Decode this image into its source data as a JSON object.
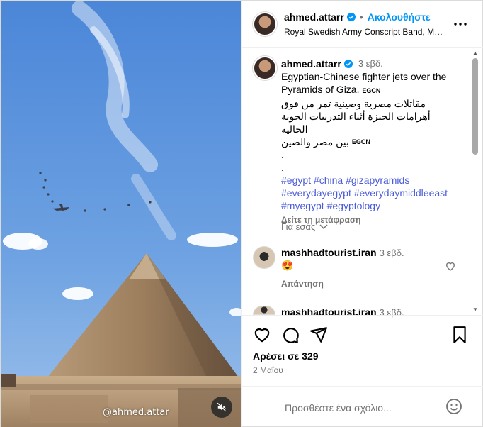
{
  "header": {
    "username": "ahmed.attarr",
    "separator": "•",
    "follow_label": "Ακολουθήστε",
    "subtitle": "Royal Swedish Army Conscript Band, Mat...",
    "more_icon": "more-horizontal-icon"
  },
  "caption": {
    "username": "ahmed.attarr",
    "time": "3 εβδ.",
    "line1": "Egyptian-Chinese fighter jets over the",
    "line2": "Pyramids of Giza.",
    "tag1": "EGCN",
    "arabic1": "مقاتلات مصرية وصينية تمر من فوق",
    "arabic2": "أهرامات الجيزة أثناء التدريبات الجوية الحالية",
    "arabic3": "بين مصر والصين",
    "tag2": "EGCN",
    "dot1": ".",
    "dot2": ".",
    "hashtags_line1": "#egypt #china #gizapyramids",
    "hashtags_line2": "#everydayegypt #everydaymiddleeast",
    "hashtags_line3": "#myegypt #egyptology",
    "translate_label": "Δείτε τη μετάφραση"
  },
  "for_you": {
    "label": "Για εσάς"
  },
  "comments": [
    {
      "username": "mashhadtourist.iran",
      "time": "3 εβδ.",
      "text": "😍",
      "reply_label": "Απάντηση"
    },
    {
      "username": "mashhadtourist.iran",
      "time": "3 εβδ."
    }
  ],
  "actions": {
    "likes": "Αρέσει σε 329",
    "date": "2 Μαΐου"
  },
  "add_comment": {
    "placeholder": "Προσθέστε ένα σχόλιο..."
  },
  "media": {
    "watermark": "@ahmed.attar"
  },
  "colors": {
    "link": "#0095f6",
    "hashtag": "#4a5bd8",
    "sky": "#5a8fd6"
  }
}
